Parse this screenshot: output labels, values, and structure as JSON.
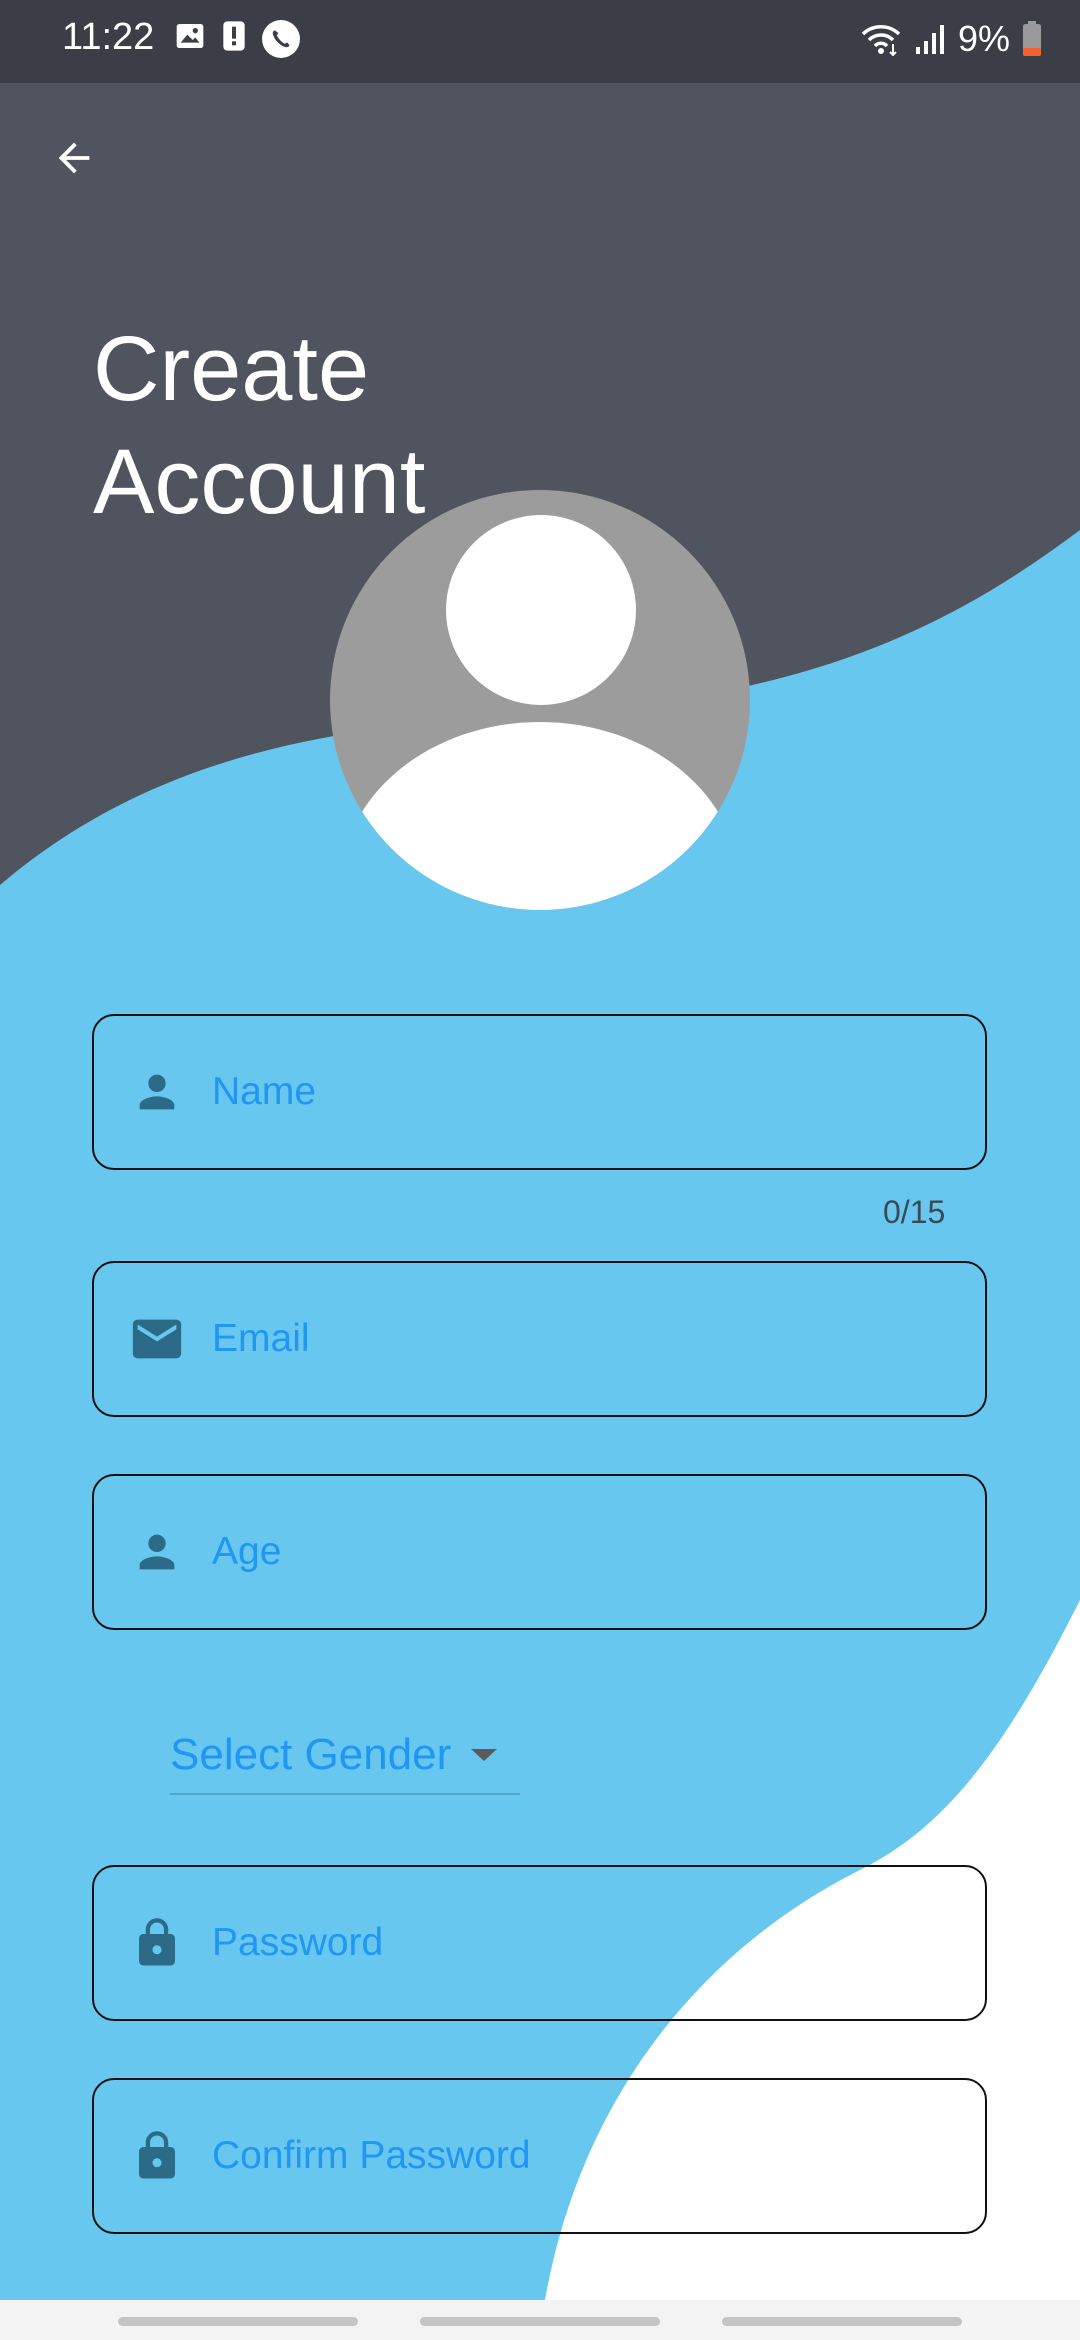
{
  "colors": {
    "status_bar": "#3b3e46",
    "header_bg": "#50545f",
    "wave_blue": "#67c7ef",
    "accent_text": "#2196f3",
    "icon_color": "#2b6b88",
    "avatar_grey": "#9c9c9c",
    "battery_low": "#f2612e"
  },
  "status_bar": {
    "time": "11:22",
    "battery": "9%",
    "left_icons": [
      "image-icon",
      "alert-icon",
      "phone-icon"
    ],
    "right_icons": [
      "wifi-icon",
      "signal-icon",
      "battery-icon"
    ]
  },
  "header": {
    "back_icon": "arrow-left-icon",
    "title_line1": "Create",
    "title_line2": "Account"
  },
  "form": {
    "name": {
      "label": "Name",
      "icon": "person-icon",
      "counter": "0/15"
    },
    "email": {
      "label": "Email",
      "icon": "mail-icon"
    },
    "age": {
      "label": "Age",
      "icon": "person-icon"
    },
    "gender": {
      "label": "Select Gender",
      "icon": "caret-down-icon"
    },
    "password": {
      "label": "Password",
      "icon": "lock-icon"
    },
    "confirm_password": {
      "label": "Confirm Password",
      "icon": "lock-icon"
    }
  }
}
